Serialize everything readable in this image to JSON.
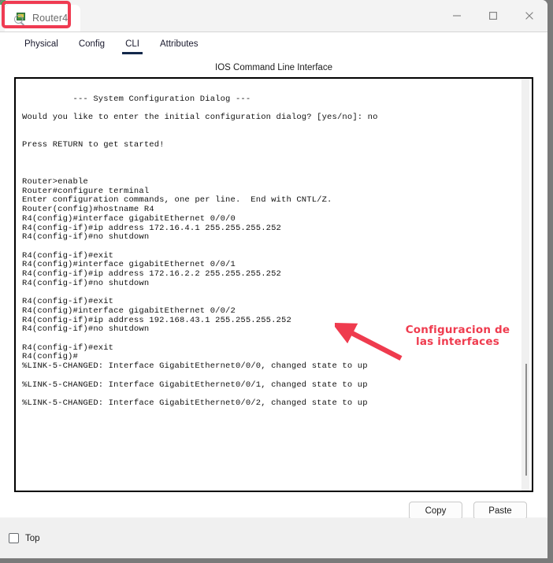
{
  "window": {
    "tab_title": "Router4",
    "tab_icon": "router-magnifier-icon",
    "minimize_label": "Minimize",
    "maximize_label": "Maximize",
    "close_label": "Close"
  },
  "tabs": [
    {
      "label": "Physical",
      "active": false
    },
    {
      "label": "Config",
      "active": false
    },
    {
      "label": "CLI",
      "active": true
    },
    {
      "label": "Attributes",
      "active": false
    }
  ],
  "cli": {
    "heading": "IOS Command Line Interface",
    "output": "\n          --- System Configuration Dialog ---\n\nWould you like to enter the initial configuration dialog? [yes/no]: no\n\n\nPress RETURN to get started!\n\n\n\nRouter>enable\nRouter#configure terminal\nEnter configuration commands, one per line.  End with CNTL/Z.\nRouter(config)#hostname R4\nR4(config)#interface gigabitEthernet 0/0/0\nR4(config-if)#ip address 172.16.4.1 255.255.255.252\nR4(config-if)#no shutdown\n\nR4(config-if)#exit\nR4(config)#interface gigabitEthernet 0/0/1\nR4(config-if)#ip address 172.16.2.2 255.255.255.252\nR4(config-if)#no shutdown\n\nR4(config-if)#exit\nR4(config)#interface gigabitEthernet 0/0/2\nR4(config-if)#ip address 192.168.43.1 255.255.255.252\nR4(config-if)#no shutdown\n\nR4(config-if)#exit\nR4(config)#\n%LINK-5-CHANGED: Interface GigabitEthernet0/0/0, changed state to up\n\n%LINK-5-CHANGED: Interface GigabitEthernet0/0/1, changed state to up\n\n%LINK-5-CHANGED: Interface GigabitEthernet0/0/2, changed state to up\n"
  },
  "annotation": {
    "text": "Configuracion de las interfaces",
    "color": "#ef3b4e",
    "arrow_name": "red-arrow-annotation"
  },
  "highlight": {
    "color": "#ef3b52"
  },
  "buttons": {
    "copy": "Copy",
    "paste": "Paste"
  },
  "footer": {
    "top_label": "Top",
    "top_checked": false
  }
}
